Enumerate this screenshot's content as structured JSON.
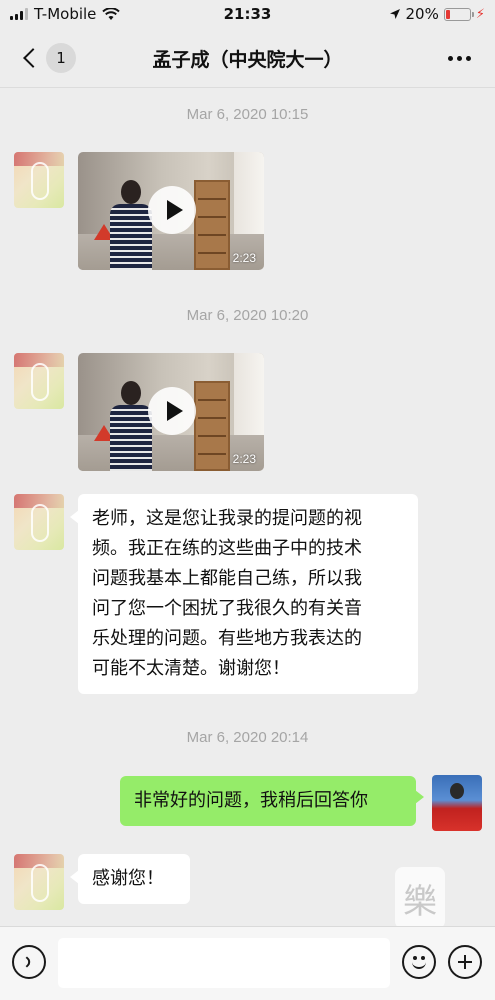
{
  "status_bar": {
    "carrier": "T-Mobile",
    "time": "21:33",
    "battery_percent": "20%",
    "battery_level": 0.2,
    "icons": [
      "signal-icon",
      "wifi-icon",
      "location-icon",
      "battery-icon",
      "charging-icon"
    ]
  },
  "nav": {
    "unread_count": "1",
    "title": "孟子成（中央院大一）"
  },
  "messages": [
    {
      "type": "timestamp",
      "text": "Mar 6, 2020 10:15"
    },
    {
      "type": "video",
      "sender": "contact",
      "duration": "2:23"
    },
    {
      "type": "timestamp",
      "text": "Mar 6, 2020 10:20"
    },
    {
      "type": "video",
      "sender": "contact",
      "duration": "2:23"
    },
    {
      "type": "text",
      "sender": "contact",
      "lines": [
        "老师，这是您让我录的提问题的视",
        "频。我正在练的这些曲子中的技术",
        "问题我基本上都能自己练，所以我",
        "问了您一个困扰了我很久的有关音",
        "乐处理的问题。有些地方我表达的",
        "可能不太清楚。谢谢您！"
      ]
    },
    {
      "type": "timestamp",
      "text": "Mar 6, 2020 20:14"
    },
    {
      "type": "text",
      "sender": "self",
      "lines": [
        "非常好的问题，我稍后回答你"
      ]
    },
    {
      "type": "text",
      "sender": "contact",
      "lines": [
        "感谢您！"
      ]
    }
  ],
  "colors": {
    "background": "#ededed",
    "outgoing_bubble": "#95ec69",
    "incoming_bubble": "#ffffff",
    "timestamp": "#a5a5a5",
    "battery_low": "#e53935"
  },
  "input_bar": {
    "placeholder": "",
    "icons": [
      "voice-icon",
      "emoji-icon",
      "plus-icon"
    ]
  }
}
